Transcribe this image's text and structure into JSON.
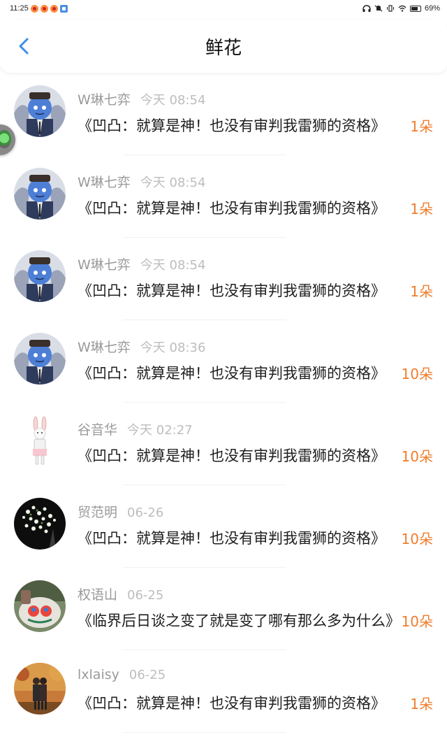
{
  "status_bar": {
    "time": "11:25",
    "battery": "69%"
  },
  "header": {
    "title": "鲜花",
    "back_icon": "chevron-left-icon"
  },
  "colors": {
    "accent": "#3d8ee6",
    "flower_count": "#ef7d2c",
    "name": "#9a9a9a",
    "time": "#bdbdbd"
  },
  "items": [
    {
      "name": "W琳七弈",
      "time": "今天 08:54",
      "message": "《凹凸：就算是神！也没有审判我雷狮的资格》",
      "count": "1朵",
      "avatar": "blue-character"
    },
    {
      "name": "W琳七弈",
      "time": "今天 08:54",
      "message": "《凹凸：就算是神！也没有审判我雷狮的资格》",
      "count": "1朵",
      "avatar": "blue-character"
    },
    {
      "name": "W琳七弈",
      "time": "今天 08:54",
      "message": "《凹凸：就算是神！也没有审判我雷狮的资格》",
      "count": "1朵",
      "avatar": "blue-character"
    },
    {
      "name": "W琳七弈",
      "time": "今天 08:36",
      "message": "《凹凸：就算是神！也没有审判我雷狮的资格》",
      "count": "10朵",
      "avatar": "blue-character"
    },
    {
      "name": "谷音华",
      "time": "今天 02:27",
      "message": "《凹凸：就算是神！也没有审判我雷狮的资格》",
      "count": "10朵",
      "avatar": "bunny"
    },
    {
      "name": "贸范明",
      "time": "06-26",
      "message": "《凹凸：就算是神！也没有审判我雷狮的资格》",
      "count": "10朵",
      "avatar": "white-flowers"
    },
    {
      "name": "权语山",
      "time": "06-25",
      "message": "《临界后日谈之变了就是变了哪有那么多为什么》",
      "count": "10朵",
      "avatar": "painted-stone"
    },
    {
      "name": "lxlaisy",
      "time": "06-25",
      "message": "《凹凸：就算是神！也没有审判我雷狮的资格》",
      "count": "1朵",
      "avatar": "couple-autumn"
    }
  ]
}
